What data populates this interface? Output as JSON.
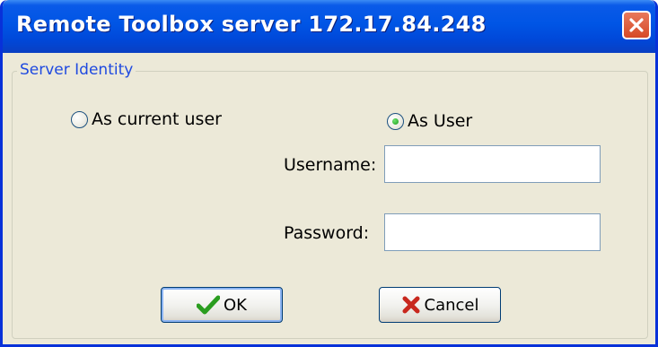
{
  "window": {
    "title": "Remote Toolbox server 172.17.84.248",
    "close_tooltip_icon": "close-icon"
  },
  "group": {
    "legend": "Server Identity"
  },
  "radios": {
    "current_user_label": "As current user",
    "current_user_selected": false,
    "as_user_label": "As User",
    "as_user_selected": true
  },
  "form": {
    "username_label": "Username:",
    "username_value": "",
    "password_label": "Password:",
    "password_value": ""
  },
  "buttons": {
    "ok_label": "OK",
    "ok_icon": "checkmark-icon",
    "cancel_label": "Cancel",
    "cancel_icon": "x-icon"
  },
  "colors": {
    "titlebar": "#0055e5",
    "dialog_background": "#ece9d8",
    "legend_text": "#1f4ae0",
    "close_button": "#d64a26",
    "ok_check": "#2a9d1f",
    "cancel_x": "#c8281e"
  }
}
